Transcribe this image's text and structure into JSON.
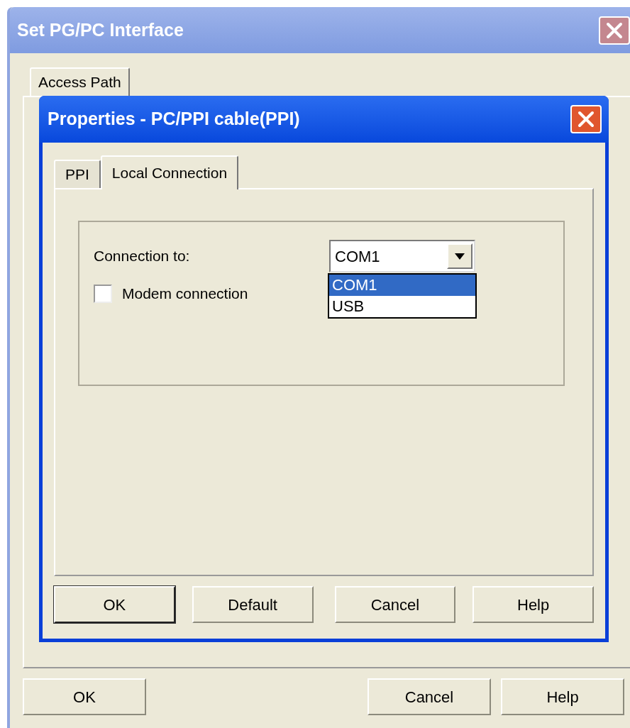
{
  "outer_window": {
    "title": "Set PG/PC Interface",
    "tabs": [
      {
        "label": "Access Path",
        "selected": true
      }
    ],
    "buttons": [
      {
        "label": "OK",
        "default": false
      },
      {
        "label": "Cancel",
        "default": false
      },
      {
        "label": "Help",
        "default": false
      }
    ]
  },
  "dialog": {
    "title": "Properties - PC/PPI cable(PPI)",
    "tabs": [
      {
        "label": "PPI",
        "selected": false
      },
      {
        "label": "Local Connection",
        "selected": true
      }
    ],
    "connection_label": "Connection to:",
    "connection_select": {
      "value": "COM1",
      "expanded": true,
      "options": [
        {
          "label": "COM1",
          "selected": true
        },
        {
          "label": "USB",
          "selected": false
        }
      ]
    },
    "modem_checkbox": {
      "label": "Modem connection",
      "checked": false
    },
    "buttons": [
      {
        "label": "OK",
        "default": true
      },
      {
        "label": "Default",
        "default": false
      },
      {
        "label": "Cancel",
        "default": false
      },
      {
        "label": "Help",
        "default": false
      }
    ]
  }
}
